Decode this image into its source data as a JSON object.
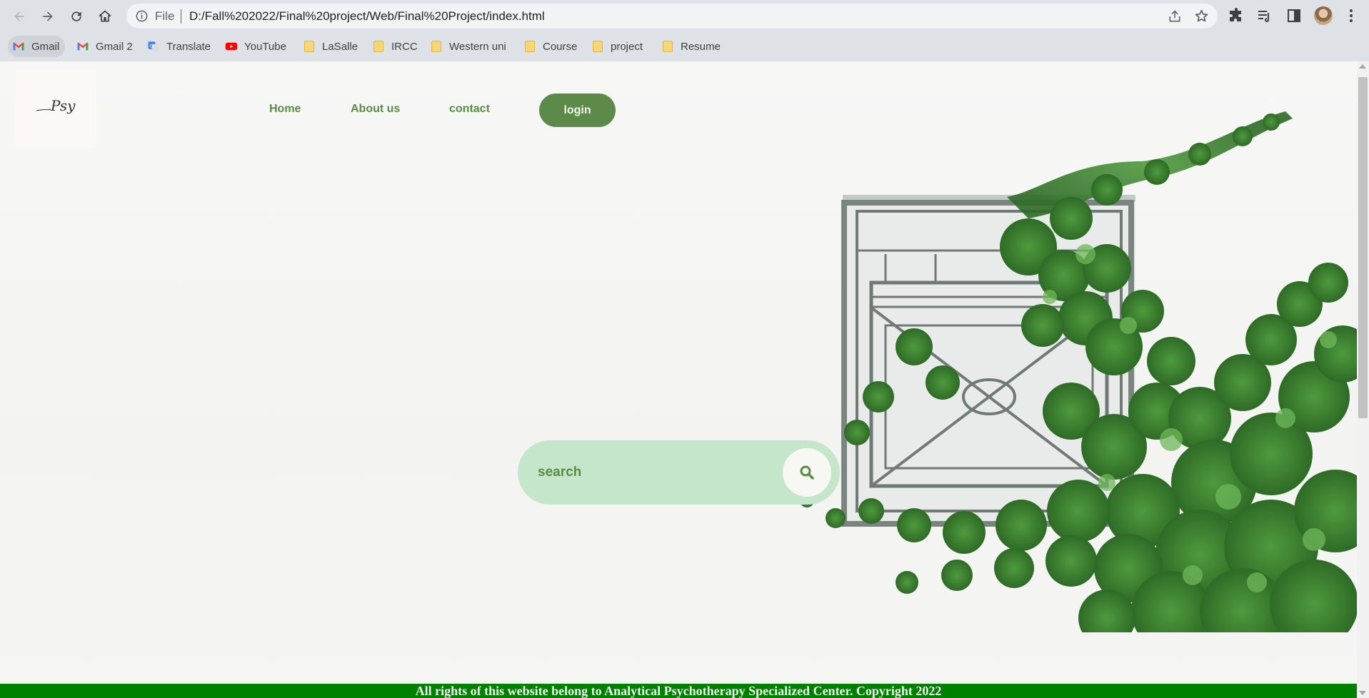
{
  "browser": {
    "omnibox": {
      "scheme_label": "File",
      "url": "D:/Fall%202022/Final%20project/Web/Final%20Project/index.html"
    },
    "icons": {
      "back": "back-arrow-icon",
      "forward": "forward-arrow-icon",
      "reload": "reload-icon",
      "home": "home-icon",
      "info": "info-icon",
      "share": "share-icon",
      "bookmark": "star-icon",
      "extensions": "puzzle-icon",
      "reading_list": "reading-list-icon",
      "side_panel": "side-panel-icon",
      "menu": "kebab-menu-icon"
    },
    "bookmarks": [
      {
        "label": "Gmail",
        "icon": "gmail-icon"
      },
      {
        "label": "Gmail 2",
        "icon": "gmail-icon"
      },
      {
        "label": "Translate",
        "icon": "translate-icon"
      },
      {
        "label": "YouTube",
        "icon": "youtube-icon"
      },
      {
        "label": "LaSalle",
        "icon": "folder-icon"
      },
      {
        "label": "IRCC",
        "icon": "folder-icon"
      },
      {
        "label": "Western uni",
        "icon": "folder-icon"
      },
      {
        "label": "Course",
        "icon": "folder-icon"
      },
      {
        "label": "project",
        "icon": "folder-icon"
      },
      {
        "label": "Resume",
        "icon": "folder-icon"
      }
    ]
  },
  "site": {
    "logo_text": "Psy",
    "nav": {
      "home": "Home",
      "about": "About us",
      "contact": "contact",
      "login": "login"
    },
    "search": {
      "placeholder": "search",
      "icon": "search-icon"
    },
    "footer": "All rights of this website belong to Analytical Psychotherapy Specialized Center. Copyright 2022",
    "colors": {
      "nav_text": "#5a8a46",
      "login_bg": "#5c8a48",
      "search_bg": "#c5e6cb",
      "footer_bg": "#008000"
    }
  }
}
